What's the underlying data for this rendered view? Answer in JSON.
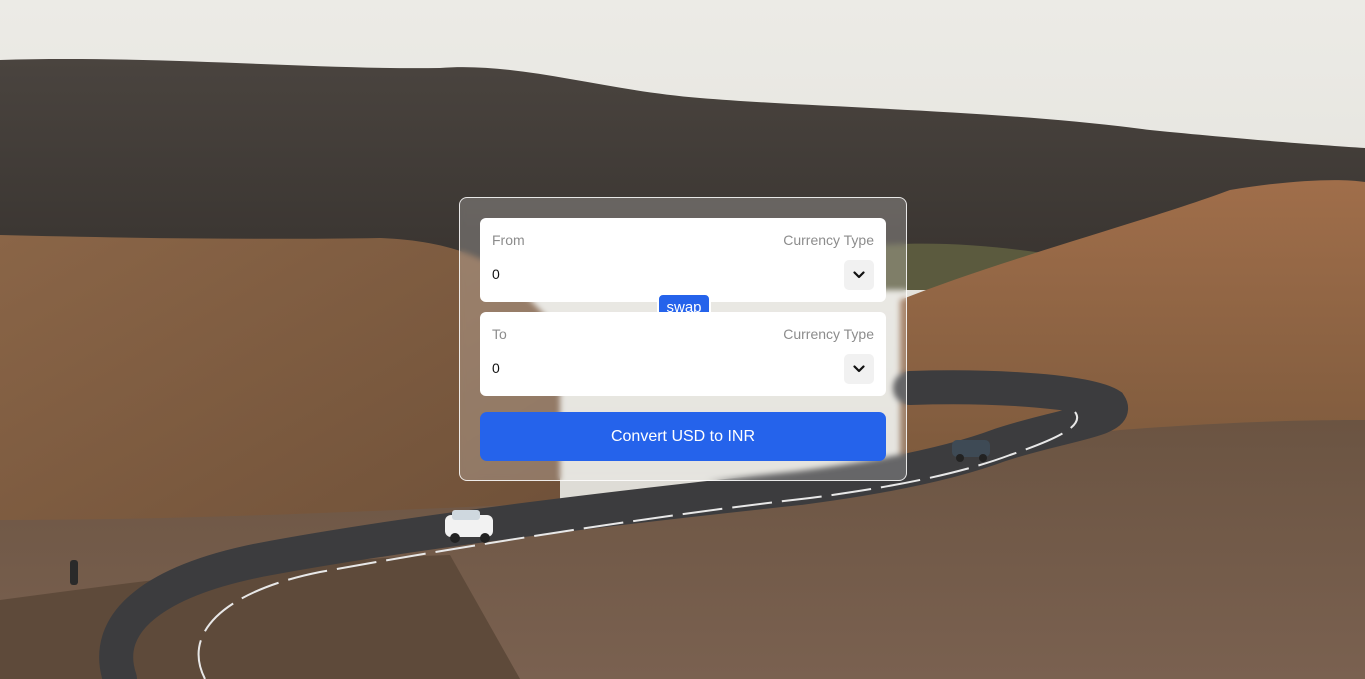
{
  "from": {
    "label": "From",
    "type_label": "Currency Type",
    "amount": "0"
  },
  "to": {
    "label": "To",
    "type_label": "Currency Type",
    "amount": "0"
  },
  "swap_label": "swap",
  "convert_label": "Convert USD to INR",
  "icons": {
    "select_chevron": "chevron-down-icon"
  },
  "colors": {
    "accent": "#2563eb",
    "card_border": "#ffffff"
  }
}
